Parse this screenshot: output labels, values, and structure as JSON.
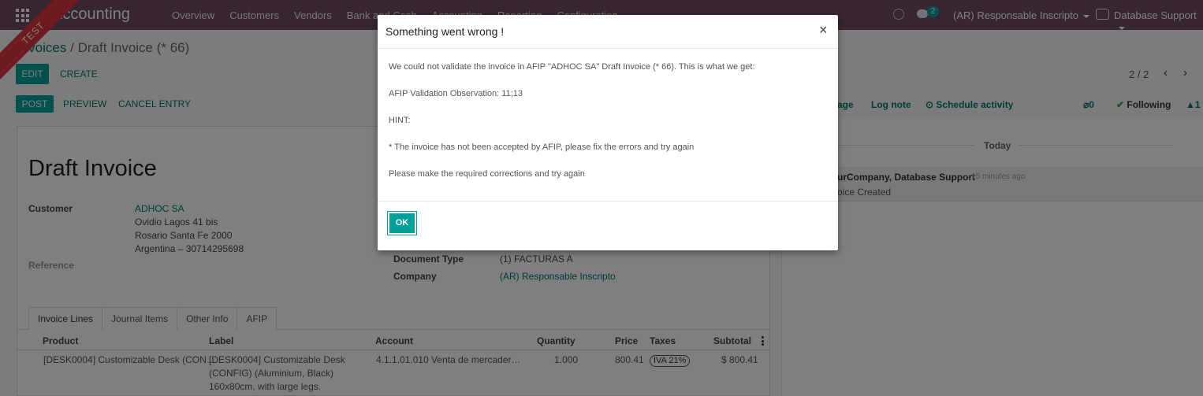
{
  "navbar": {
    "app_title": "Accounting",
    "menu": [
      "Overview",
      "Customers",
      "Vendors",
      "Bank and Cash",
      "Accounting",
      "Reporting",
      "Configuration"
    ],
    "chat_count": "2",
    "company": "(AR) Responsable Inscripto",
    "user": "Database Support",
    "ribbon": "TEST"
  },
  "breadcrumb": {
    "parent": "Invoices",
    "separator": "/",
    "current": "Draft Invoice (* 66)"
  },
  "buttons": {
    "edit": "EDIT",
    "create": "CREATE",
    "post": "POST",
    "preview": "PREVIEW",
    "cancel_entry": "CANCEL ENTRY"
  },
  "pager": {
    "value": "2 / 2"
  },
  "form": {
    "title": "Draft Invoice",
    "customer_label": "Customer",
    "customer_name": "ADHOC SA",
    "address_line1": "Ovidio Lagos 41 bis",
    "address_line2": "Rosario Santa Fe 2000",
    "address_line3": "Argentina – 30714295698",
    "reference_label": "Reference",
    "doc_type_label": "Document Type",
    "doc_type_value": "(1) FACTURAS A",
    "company_label": "Company",
    "company_value": "(AR) Responsable Inscripto"
  },
  "tabs": [
    "Invoice Lines",
    "Journal Items",
    "Other Info",
    "AFIP"
  ],
  "table": {
    "headers": {
      "product": "Product",
      "label": "Label",
      "account": "Account",
      "quantity": "Quantity",
      "price": "Price",
      "taxes": "Taxes",
      "subtotal": "Subtotal"
    },
    "row": {
      "product": "[DESK0004] Customizable Desk (CON…",
      "label_line1": "[DESK0004] Customizable Desk",
      "label_line2": "(CONFIG) (Aluminium, Black)",
      "label_line3": "160x80cm, with large legs.",
      "account": "4.1.1.01.010 Venta de mercader…",
      "quantity": "1.000",
      "price": "800.41",
      "tax": "IVA 21%",
      "subtotal": "$ 800.41"
    }
  },
  "chatter": {
    "send_message": "age",
    "log_note": "Log note",
    "schedule_activity": "Schedule activity",
    "attachments": "0",
    "following": "Following",
    "followers": "1",
    "today": "Today",
    "author": "urCompany, Database Support",
    "time": "- 15 minutes ago",
    "body": "oice Created"
  },
  "modal": {
    "title": "Something went wrong !",
    "close": "×",
    "line1": "We could not validate the invoice in AFIP \"ADHOC SA\" Draft Invoice (* 66). This is what we get:",
    "line2": "AFIP Validation Observation: 11;13",
    "line3": "HINT:",
    "line4": " * The invoice has not been accepted by AFIP, please fix the errors and try again",
    "line5": "Please make the required corrections and try again",
    "ok": "OK"
  }
}
